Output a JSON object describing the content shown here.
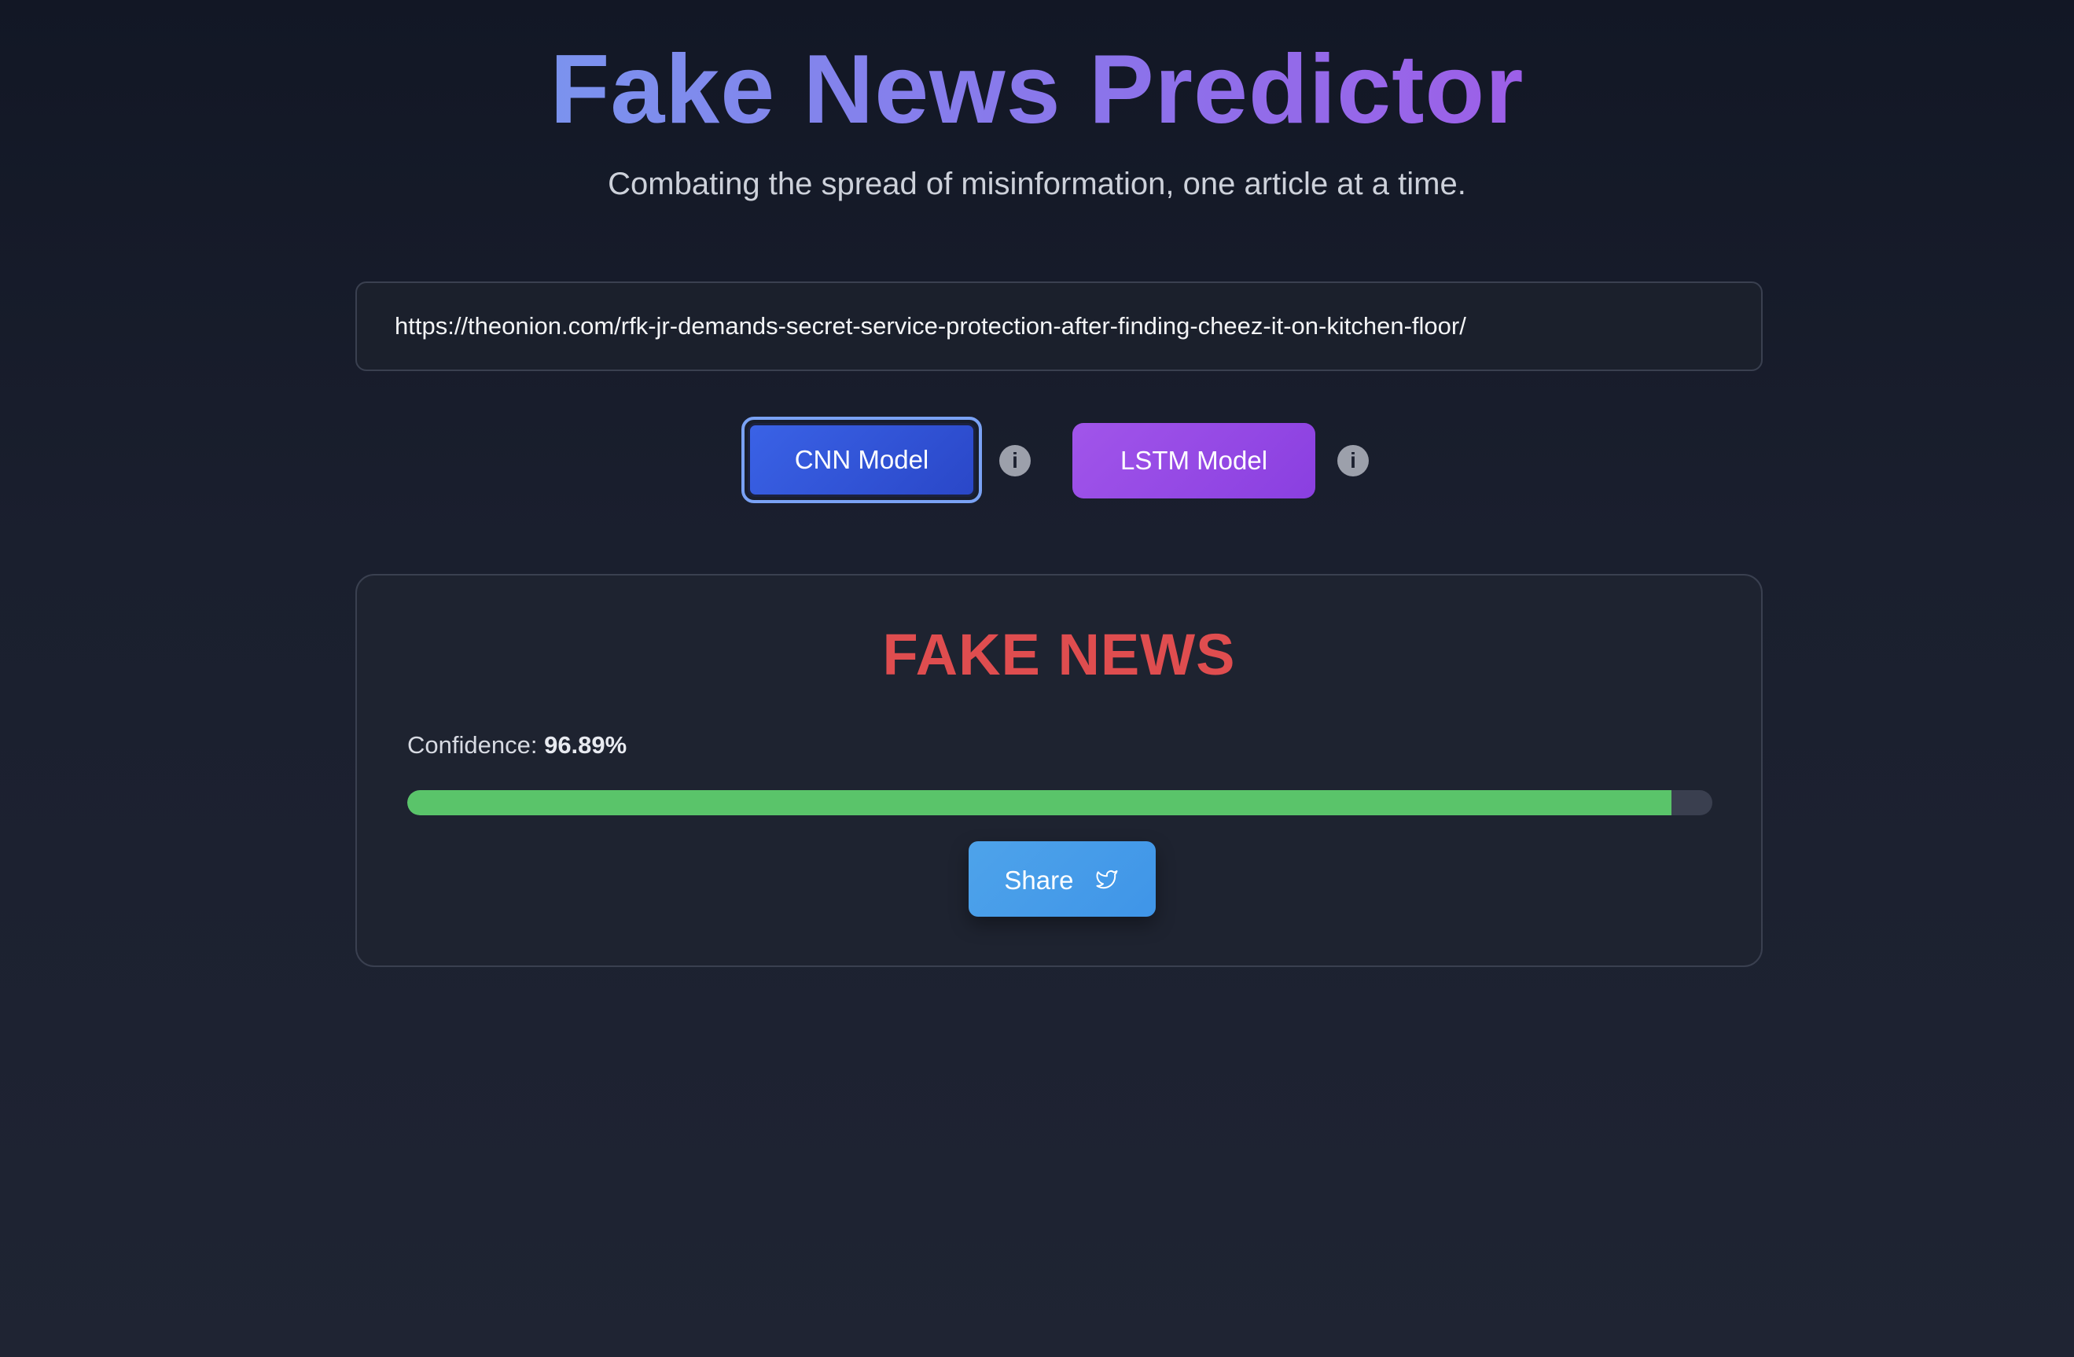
{
  "header": {
    "title": "Fake News Predictor",
    "subtitle": "Combating the spread of misinformation, one article at a time."
  },
  "url_input": {
    "value": "https://theonion.com/rfk-jr-demands-secret-service-protection-after-finding-cheez-it-on-kitchen-floor/"
  },
  "models": {
    "cnn_label": "CNN Model",
    "lstm_label": "LSTM Model",
    "selected": "CNN Model",
    "info_glyph": "i"
  },
  "result": {
    "verdict": "FAKE NEWS",
    "confidence_label": "Confidence:",
    "confidence_value": "96.89%",
    "confidence_fraction": 0.9689,
    "share_label": "Share",
    "share_icon": "twitter-bird-icon"
  },
  "colors": {
    "verdict": "#df4d4f",
    "progress_fill": "#5ac46a",
    "cnn_button": "#3a62e6",
    "lstm_button": "#a155ea",
    "share_button": "#4ea3ea"
  }
}
